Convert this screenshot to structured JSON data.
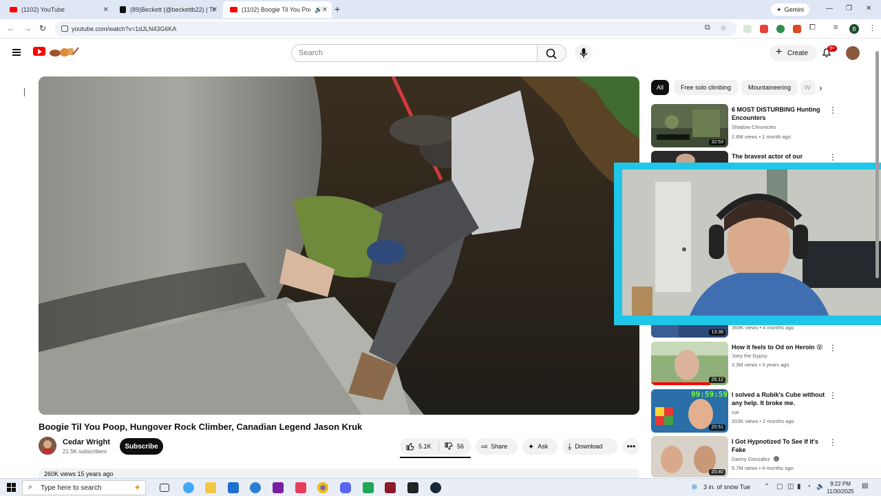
{
  "browser": {
    "tabs": [
      {
        "label": "(1102) YouTube",
        "favicon": "youtube-favicon"
      },
      {
        "label": "(89)Beckett (@beckettb22) | TikTok",
        "favicon": "tiktok-favicon"
      },
      {
        "label": "(1102) Boogie Til You Poop",
        "favicon": "youtube-favicon",
        "active": true
      }
    ],
    "gemini_label": "Gemini",
    "url": "youtube.com/watch?v=1dJLN43G6KA",
    "profile_initial": "B"
  },
  "masthead": {
    "search_placeholder": "Search",
    "create_label": "Create",
    "notifications_badge": "9+"
  },
  "video": {
    "title": "Boogie Til You Poop, Hungover Rock Climber, Canadian Legend Jason Kruk",
    "channel_name": "Cedar Wright",
    "subscribers": "21.5K subscribers",
    "subscribe_label": "Subscribe",
    "likes": "5.1K",
    "dislikes": "56",
    "share_label": "Share",
    "ask_label": "Ask",
    "download_label": "Download",
    "description_peek": "260K views  15 years ago"
  },
  "chips": [
    "All",
    "Free solo climbing",
    "Mountaineering",
    "W"
  ],
  "recommendations": [
    {
      "title": "6 MOST DISTURBING Hunting Encounters",
      "channel": "Shadow Chronicles",
      "meta": "2.8M views • 1 month ago",
      "duration": "32:53"
    },
    {
      "title": "The bravest actor of our",
      "channel": "",
      "meta": "",
      "duration": ""
    },
    {
      "title": "",
      "channel": "",
      "meta": "369K views • 4 months ago",
      "duration": "13:38"
    },
    {
      "title": "How it feels to Od on Heroin 😵",
      "channel": "Joey the Gypsy",
      "meta": "3.3M views • 3 years ago",
      "duration": "25:12"
    },
    {
      "title": "I solved a Rubik's Cube without any help. It broke me.",
      "channel": "rue",
      "meta": "203K views • 2 months ago",
      "duration": "20:51",
      "thumb_text": "99:59:59"
    },
    {
      "title": "I Got Hypnotized To See If It's Fake",
      "channel": "Danny Gonzalez",
      "meta": "5.7M views • 4 months ago",
      "duration": "20:40"
    }
  ],
  "taskbar": {
    "search_placeholder": "Type here to search",
    "weather": "3 in. of snow Tue",
    "time": "9:22 PM",
    "date": "11/30/2025"
  }
}
